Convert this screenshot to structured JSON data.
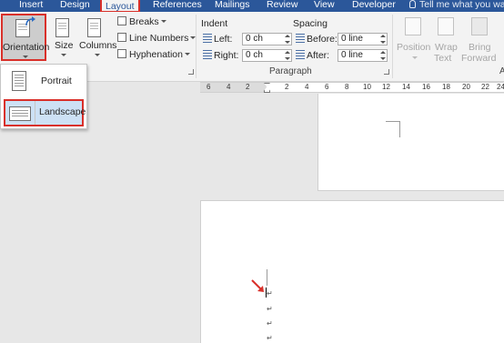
{
  "tabs": [
    {
      "label": "Insert",
      "active": false
    },
    {
      "label": "Design",
      "active": false
    },
    {
      "label": "Layout",
      "active": true
    },
    {
      "label": "References",
      "active": false
    },
    {
      "label": "Mailings",
      "active": false
    },
    {
      "label": "Review",
      "active": false
    },
    {
      "label": "View",
      "active": false
    },
    {
      "label": "Developer",
      "active": false
    }
  ],
  "tell_me": "Tell me what you wa",
  "page_setup": {
    "orientation_label": "Orientation",
    "size_label": "Size",
    "columns_label": "Columns",
    "breaks_label": "Breaks",
    "line_numbers_label": "Line Numbers",
    "hyphenation_label": "Hyphenation"
  },
  "paragraph": {
    "group_label": "Paragraph",
    "indent_title": "Indent",
    "spacing_title": "Spacing",
    "left_label": "Left:",
    "left_value": "0 ch",
    "right_label": "Right:",
    "right_value": "0 ch",
    "before_label": "Before:",
    "before_value": "0 line",
    "after_label": "After:",
    "after_value": "0 line"
  },
  "arrange": {
    "position_label": "Position",
    "wrap_label": "Wrap",
    "wrap_label2": "Text",
    "bring_label": "Bring",
    "bring_label2": "Forward",
    "group_label_partial": "A"
  },
  "orientation_menu": {
    "items": [
      {
        "label": "Portrait",
        "selected": false
      },
      {
        "label": "Landscape",
        "selected": true
      }
    ]
  },
  "ruler": {
    "ticks": [
      "6",
      "4",
      "2",
      "2",
      "4",
      "6",
      "8",
      "10",
      "12",
      "14",
      "16",
      "18",
      "20",
      "22",
      "24"
    ]
  },
  "document": {
    "pilcrow": "↵"
  },
  "colors": {
    "tabbar": "#2b579a",
    "highlight_border": "#d9302a",
    "selected_fill": "#cde1f5"
  }
}
